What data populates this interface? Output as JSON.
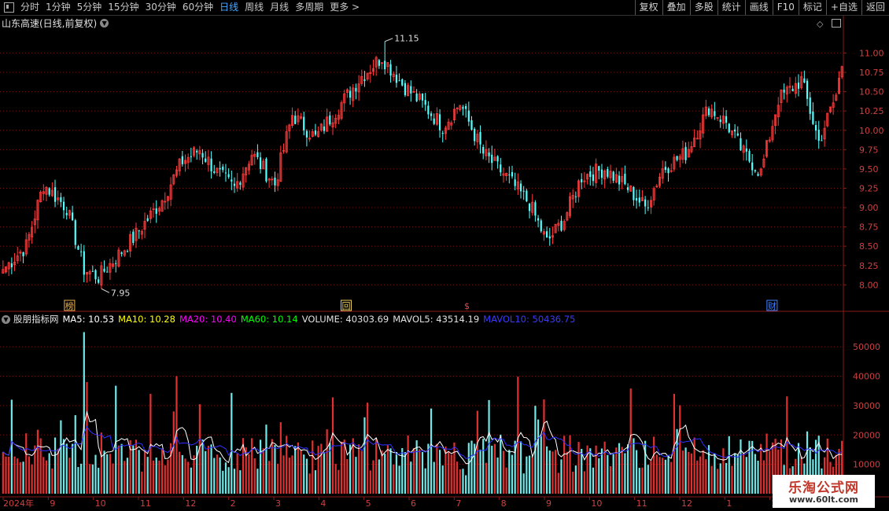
{
  "toolbar": {
    "periods": [
      "分时",
      "1分钟",
      "5分钟",
      "15分钟",
      "30分钟",
      "60分钟",
      "日线",
      "周线",
      "月线",
      "多周期",
      "更多 >"
    ],
    "active_index": 6,
    "right_buttons": [
      "复权",
      "叠加",
      "多股",
      "统计",
      "画线",
      "F10",
      "标记",
      "+自选",
      "返回"
    ]
  },
  "chart_header": {
    "title": "山东高速(日线,前复权)"
  },
  "indicator_header": {
    "name": "股朋指标网",
    "ma5": "MA5: 10.53",
    "ma10": "MA10: 10.28",
    "ma20": "MA20: 10.40",
    "ma60": "MA60: 10.14",
    "volume": "VOLUME: 40303.69",
    "mavol5": "MAVOL5: 43514.19",
    "mavol10": "MAVOL10: 50436.75"
  },
  "colors": {
    "up": "#ff3b3b",
    "down": "#54ffff",
    "grid": "#7a1010",
    "ma5": "#ffffff",
    "ma10": "#ffff00",
    "ma20": "#ff00ff",
    "ma60": "#00ff00",
    "mavol10": "#3030ff"
  },
  "markers": [
    "榜",
    "回",
    "$",
    "财"
  ],
  "watermark": {
    "line1": "乐淘公式网",
    "line2": "www.60lt.com"
  },
  "chart_data": [
    {
      "type": "candlestick",
      "title": "山东高速(日线,前复权)",
      "ylim": [
        7.8,
        11.3
      ],
      "yticks": [
        "11.00",
        "10.75",
        "10.50",
        "10.25",
        "10.00",
        "9.75",
        "9.50",
        "9.25",
        "9.00",
        "8.75",
        "8.50",
        "8.25",
        "8.00"
      ],
      "annotations": [
        {
          "label": "11.15",
          "value": 11.15,
          "kind": "high"
        },
        {
          "label": "7.95",
          "value": 7.95,
          "kind": "low"
        }
      ],
      "anchors": [
        {
          "day": 0,
          "close": 8.2
        },
        {
          "day": 8,
          "close": 8.5
        },
        {
          "day": 14,
          "close": 9.3
        },
        {
          "day": 22,
          "close": 9.0
        },
        {
          "day": 28,
          "close": 8.2
        },
        {
          "day": 33,
          "close": 8.1
        },
        {
          "day": 45,
          "close": 8.6
        },
        {
          "day": 55,
          "close": 9.1
        },
        {
          "day": 62,
          "close": 9.6
        },
        {
          "day": 68,
          "close": 9.75
        },
        {
          "day": 74,
          "close": 9.45
        },
        {
          "day": 80,
          "close": 9.25
        },
        {
          "day": 86,
          "close": 9.7
        },
        {
          "day": 94,
          "close": 9.3
        },
        {
          "day": 100,
          "close": 10.2
        },
        {
          "day": 108,
          "close": 9.9
        },
        {
          "day": 116,
          "close": 10.3
        },
        {
          "day": 124,
          "close": 10.7
        },
        {
          "day": 131,
          "close": 10.95
        },
        {
          "day": 138,
          "close": 10.6
        },
        {
          "day": 146,
          "close": 10.3
        },
        {
          "day": 152,
          "close": 10.05
        },
        {
          "day": 158,
          "close": 10.35
        },
        {
          "day": 166,
          "close": 9.7
        },
        {
          "day": 174,
          "close": 9.4
        },
        {
          "day": 182,
          "close": 9.05
        },
        {
          "day": 188,
          "close": 8.55
        },
        {
          "day": 194,
          "close": 8.85
        },
        {
          "day": 200,
          "close": 9.4
        },
        {
          "day": 208,
          "close": 9.5
        },
        {
          "day": 216,
          "close": 9.25
        },
        {
          "day": 222,
          "close": 9.0
        },
        {
          "day": 228,
          "close": 9.5
        },
        {
          "day": 236,
          "close": 9.7
        },
        {
          "day": 244,
          "close": 10.3
        },
        {
          "day": 250,
          "close": 10.1
        },
        {
          "day": 256,
          "close": 9.7
        },
        {
          "day": 262,
          "close": 9.45
        },
        {
          "day": 268,
          "close": 10.4
        },
        {
          "day": 276,
          "close": 10.65
        },
        {
          "day": 282,
          "close": 9.85
        },
        {
          "day": 288,
          "close": 10.45
        },
        {
          "day": 290,
          "close": 10.85
        }
      ]
    },
    {
      "type": "bar",
      "title": "VOLUME",
      "ylim": [
        0,
        57000
      ],
      "yticks": [
        "50000",
        "40000",
        "30000",
        "20000",
        "10000"
      ],
      "x_labels": [
        "2024年",
        "9",
        "10",
        "11",
        "12",
        "2",
        "3",
        "4",
        "5",
        "6",
        "7",
        "8",
        "9",
        "10",
        "11",
        "12",
        "1",
        "2",
        "3"
      ]
    }
  ]
}
